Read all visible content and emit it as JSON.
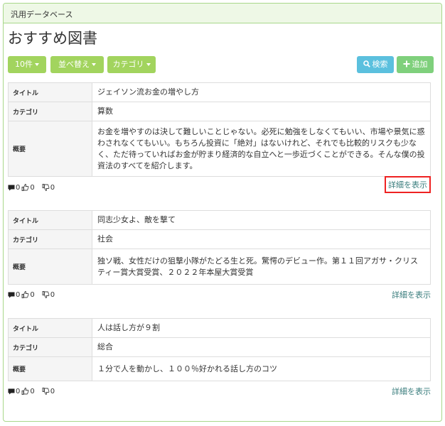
{
  "header": {
    "title": "汎用データベース"
  },
  "page": {
    "title": "おすすめ図書"
  },
  "toolbar": {
    "count_label": "10件",
    "sort_label": "並べ替え",
    "category_label": "カテゴリ",
    "search_label": "検索",
    "add_label": "追加"
  },
  "labels": {
    "title": "タイトル",
    "category": "カテゴリ",
    "summary": "概要",
    "detail": "詳細を表示"
  },
  "records": [
    {
      "title": "ジェイソン流お金の増やし方",
      "category": "算数",
      "summary": "お金を増やすのは決して難しいことじゃない。必死に勉強をしなくてもいい、市場や景気に惑わされなくてもいい。もちろん投資に「絶対」はないけれど、それでも比較的リスクも少なく、ただ待っていればお金が貯まり経済的な自立へと一歩近づくことができる。そんな僕の投資法のすべてを紹介します。",
      "comments": "0",
      "likes": "0",
      "dislikes": "0"
    },
    {
      "title": "同志少女よ、敵を撃て",
      "category": "社会",
      "summary": "独ソ戦、女性だけの狙撃小隊がたどる生と死。驚愕のデビュー作。第１１回アガサ・クリスティー賞大賞受賞、２０２２年本屋大賞受賞",
      "comments": "0",
      "likes": "0",
      "dislikes": "0"
    },
    {
      "title": "人は話し方が９割",
      "category": "総合",
      "summary": "１分で人を動かし、１００％好かれる話し方のコツ",
      "comments": "0",
      "likes": "0",
      "dislikes": "0"
    }
  ],
  "colors": {
    "accent": "#a2d45e",
    "search": "#5bc0de",
    "link": "#3a7d7d",
    "highlight": "#e22222"
  },
  "icons": [
    "comment-icon",
    "thumbs-up-icon",
    "thumbs-down-icon",
    "search-icon",
    "plus-icon"
  ]
}
